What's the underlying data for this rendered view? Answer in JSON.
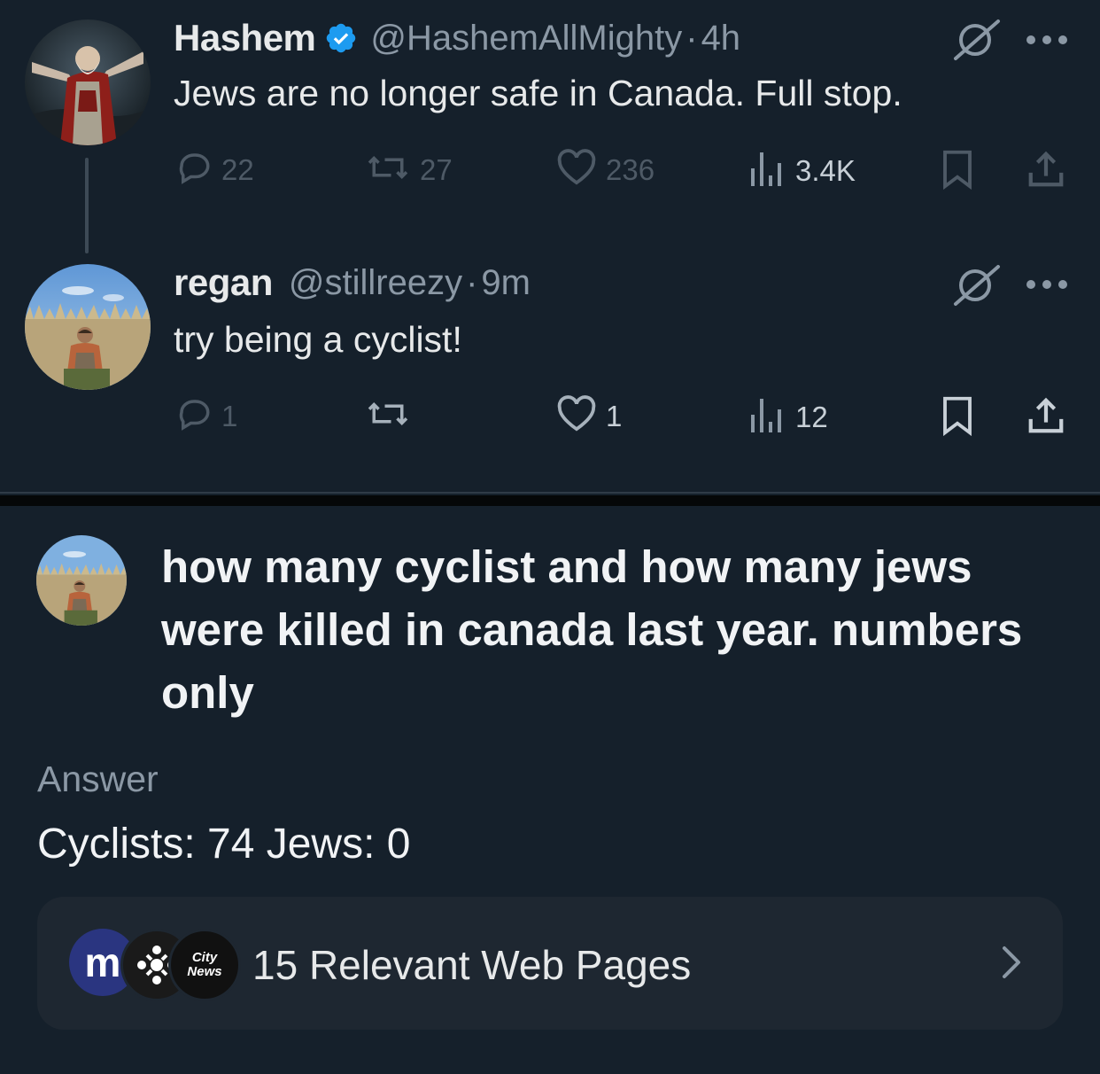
{
  "thread": {
    "tweets": [
      {
        "name": "Hashem",
        "verified": true,
        "handle": "@HashemAllMighty",
        "separator": "·",
        "time": "4h",
        "text": "Jews are no longer safe in Canada. Full stop.",
        "stats": {
          "replies": "22",
          "reposts": "27",
          "likes": "236",
          "views": "3.4K"
        }
      },
      {
        "name": "regan",
        "verified": false,
        "handle": "@stillreezy",
        "separator": "·",
        "time": "9m",
        "text": "try being a cyclist!",
        "stats": {
          "replies": "1",
          "reposts": "",
          "likes": "1",
          "views": "12"
        }
      }
    ]
  },
  "grok": {
    "question": "how many cyclist and how many jews were killed in canada last year. numbers only",
    "answer_label": "Answer",
    "answer": "Cyclists: 74 Jews: 0",
    "sources": {
      "label": "15 Relevant Web Pages",
      "icons": [
        "m",
        "CBC",
        "City News"
      ]
    }
  },
  "colors": {
    "background": "#15202b",
    "verified_blue": "#1d9bf0",
    "muted_text": "#8b98a5"
  }
}
